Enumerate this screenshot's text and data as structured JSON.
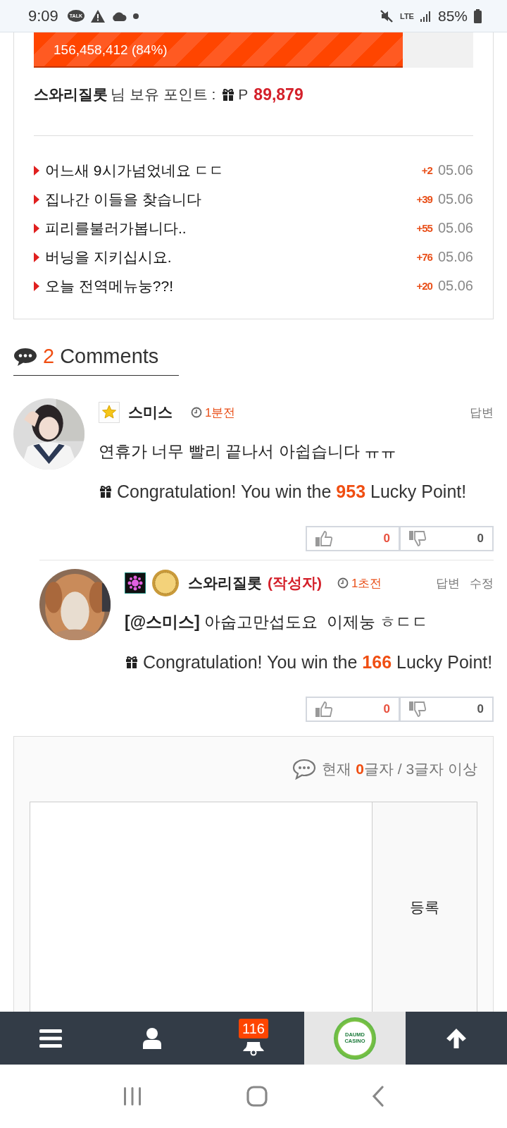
{
  "status_bar": {
    "time": "9:09",
    "talk_icon_text": "TALK",
    "network": "LTE",
    "battery": "85%"
  },
  "progress": {
    "label": "156,458,412 (84%)",
    "level": 0.84
  },
  "points": {
    "user": "스와리질롯",
    "suffix": "님 보유 포인트 :",
    "currency": "P",
    "value": "89,879"
  },
  "posts": [
    {
      "title": "어느새 9시가넘었네요 ㄷㄷ",
      "points": "+2",
      "date": "05.06"
    },
    {
      "title": "집나간 이들을 찾습니다",
      "points": "+39",
      "date": "05.06"
    },
    {
      "title": "피리를불러가봅니다..",
      "points": "+55",
      "date": "05.06"
    },
    {
      "title": "버닝을 지키십시요.",
      "points": "+76",
      "date": "05.06"
    },
    {
      "title": "오늘 전역메뉴눙??!",
      "points": "+20",
      "date": "05.06"
    }
  ],
  "comments_header": {
    "count": "2",
    "label": "Comments"
  },
  "comments": [
    {
      "reply": false,
      "badges": [
        {
          "kind": "star"
        }
      ],
      "author": "스미스",
      "time": "1분전",
      "actions": [
        "답변"
      ],
      "text": "연휴가 너무 빨리 끝나서 아쉽습니다 ㅠㅠ",
      "reward": {
        "before": "Congratulation! You win the",
        "amount": "953",
        "after": "Lucky Point!"
      },
      "likes": "0",
      "dislikes": "0"
    },
    {
      "reply": true,
      "badges": [
        {
          "kind": "gem"
        },
        {
          "kind": "coin"
        }
      ],
      "author": "스와리질롯",
      "author_tag": "(작성자)",
      "time": "1초전",
      "actions": [
        "답변",
        "수정"
      ],
      "text": "**[@스미스]** 아숩고만섭도요  이제눙 ㅎㄷㄷ",
      "reward": {
        "before": "Congratulation! You win the",
        "amount": "166",
        "after": "Lucky Point!"
      },
      "likes": "0",
      "dislikes": "0"
    }
  ],
  "comment_form": {
    "counter_prefix": "현재",
    "count": "0",
    "counter_suffix": "글자 / 3글자 이상",
    "submit": "등록"
  },
  "bottom_nav": {
    "badge": "116",
    "logo_lines": [
      "DAUMD",
      "CASINO"
    ]
  }
}
